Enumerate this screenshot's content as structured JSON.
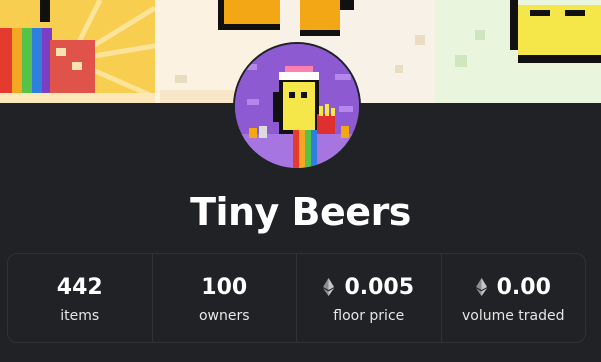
{
  "collection": {
    "name": "Tiny Beers"
  },
  "colors": {
    "background": "#202225",
    "border": "#2f3236",
    "text": "#ffffff"
  },
  "stats": [
    {
      "value": "442",
      "label": "items",
      "icon": ""
    },
    {
      "value": "100",
      "label": "owners",
      "icon": ""
    },
    {
      "value": "0.005",
      "label": "floor price",
      "icon": "ethereum-icon"
    },
    {
      "value": "0.00",
      "label": "volume traded",
      "icon": "ethereum-icon"
    }
  ]
}
